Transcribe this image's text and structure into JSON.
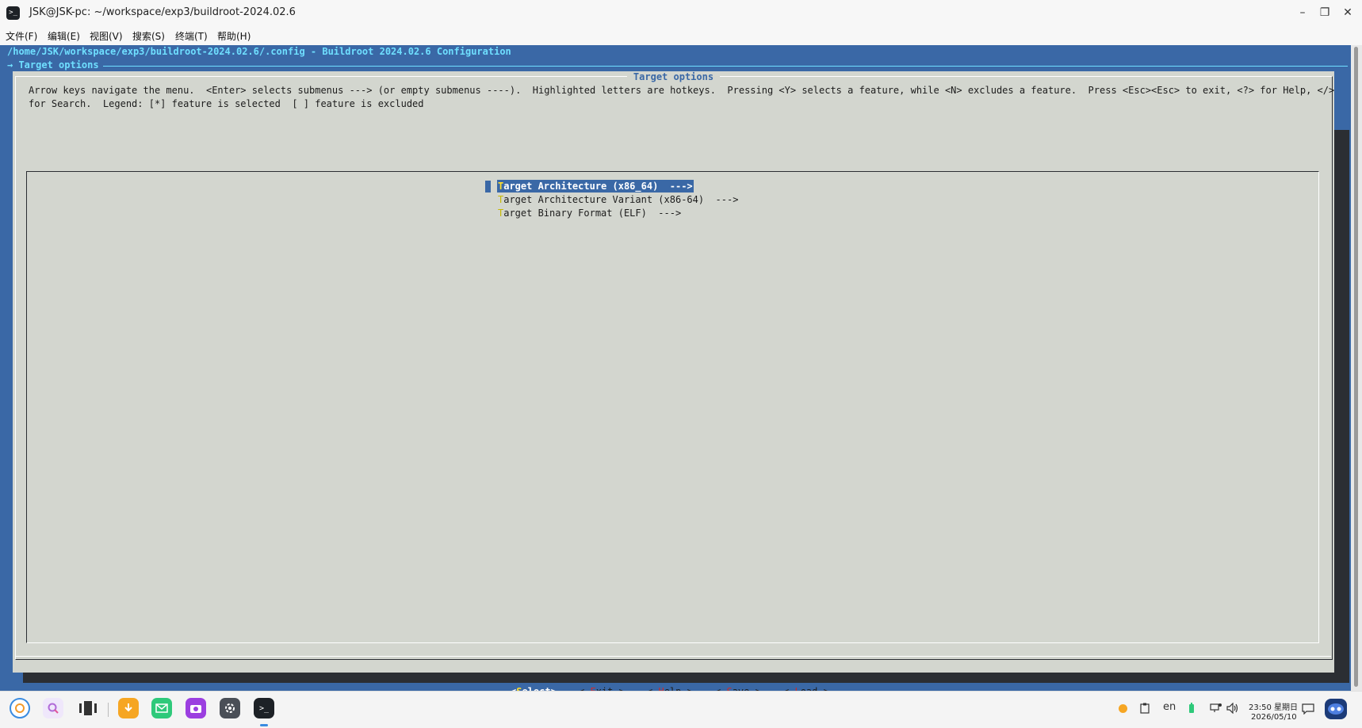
{
  "window": {
    "title": "JSK@JSK-pc: ~/workspace/exp3/buildroot-2024.02.6",
    "app_icon": ">_",
    "minimize_glyph": "–",
    "restore_glyph": "❐",
    "close_glyph": "✕"
  },
  "menubar": [
    {
      "label": "文件(F)"
    },
    {
      "label": "编辑(E)"
    },
    {
      "label": "视图(V)"
    },
    {
      "label": "搜索(S)"
    },
    {
      "label": "终端(T)"
    },
    {
      "label": "帮助(H)"
    }
  ],
  "terminal": {
    "config_path": "/home/JSK/workspace/exp3/buildroot-2024.02.6/.config - Buildroot 2024.02.6 Configuration",
    "breadcrumb": "→ Target options",
    "dialog_title": "Target options",
    "help_line1": "Arrow keys navigate the menu.  <Enter> selects submenus ---> (or empty submenus ----).  Highlighted letters are hotkeys.  Pressing <Y> selects a feature, while <N> excludes a feature.  Press <Esc><Esc> to exit, <?> for Help, </>",
    "help_line2": "for Search.  Legend: [*] feature is selected  [ ] feature is excluded",
    "menu_entries": [
      {
        "hotkey": "T",
        "rest": "arget Architecture (x86_64)  --->",
        "selected": true
      },
      {
        "hotkey": "T",
        "rest": "arget Architecture Variant (x86-64)  --->",
        "selected": false
      },
      {
        "hotkey": "T",
        "rest": "arget Binary Format (ELF)  --->",
        "selected": false
      }
    ],
    "buttons": {
      "select": {
        "pre": "<",
        "hot": "S",
        "post": "elect>"
      },
      "exit": {
        "pre": "< ",
        "hot": "E",
        "post": "xit >"
      },
      "help": {
        "pre": "< ",
        "hot": "H",
        "post": "elp >"
      },
      "save": {
        "pre": "< ",
        "hot": "S",
        "post": "ave >"
      },
      "load": {
        "pre": "< ",
        "hot": "L",
        "post": "oad >"
      }
    }
  },
  "taskbar": {
    "apps": [
      {
        "icon": "launcher-icon",
        "color": "#3a8be0"
      },
      {
        "icon": "search-icon",
        "color": "#b06ad8"
      },
      {
        "icon": "multitask-view-icon",
        "color": "#333333"
      },
      {
        "icon": "app-store-icon",
        "color": "#f6a623"
      },
      {
        "icon": "mail-icon",
        "color": "#2ec97a"
      },
      {
        "icon": "camera-icon",
        "color": "#9b3fe0"
      },
      {
        "icon": "settings-icon",
        "color": "#4a4f57"
      },
      {
        "icon": "terminal-icon",
        "color": "#1d2126"
      }
    ],
    "tray": {
      "language": "en"
    },
    "clock_time": "23:50 星期日",
    "clock_date": "2026/05/10"
  },
  "colors": {
    "terminal_bg": "#3a68a6",
    "dialog_bg": "#d3d6cf",
    "highlight": "#3a68a6",
    "path_text": "#6fdfff"
  }
}
